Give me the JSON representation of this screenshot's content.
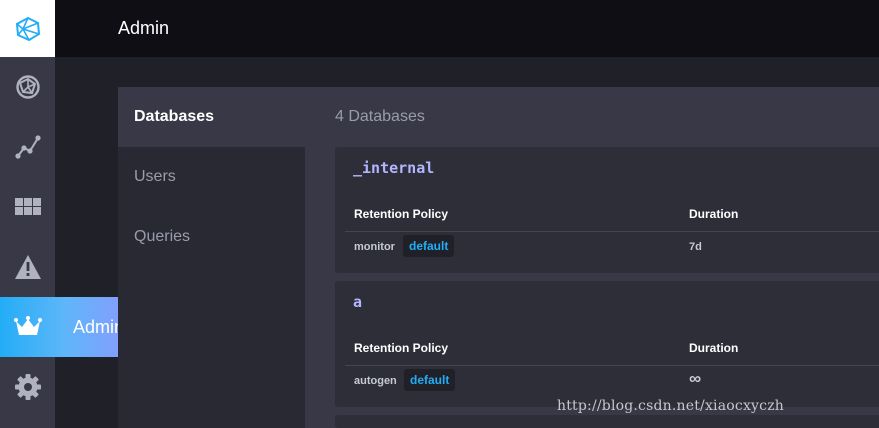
{
  "header": {
    "title": "Admin"
  },
  "rail": {
    "logo_icon": "chronograf-logo-icon",
    "items": [
      {
        "icon": "host-list-icon"
      },
      {
        "icon": "data-explorer-icon"
      },
      {
        "icon": "dashboards-icon"
      },
      {
        "icon": "alert-icon"
      },
      {
        "icon": "crown-icon",
        "label": "Admin",
        "active": true
      },
      {
        "icon": "gear-icon"
      }
    ],
    "active_gradient": [
      "#22adf6",
      "#9394ff"
    ]
  },
  "subnav": {
    "items": [
      {
        "label": "Databases",
        "active": true
      },
      {
        "label": "Users"
      },
      {
        "label": "Queries"
      }
    ]
  },
  "main": {
    "heading": "4 Databases",
    "databases": [
      {
        "name": "_internal",
        "columns": [
          "Retention Policy",
          "Duration"
        ],
        "policies": [
          {
            "name": "monitor",
            "badge": "default",
            "duration": "7d"
          }
        ]
      },
      {
        "name": "a",
        "columns": [
          "Retention Policy",
          "Duration"
        ],
        "policies": [
          {
            "name": "autogen",
            "badge": "default",
            "duration": "∞"
          }
        ]
      }
    ]
  },
  "watermark": "http://blog.csdn.net/xiaocxyczh",
  "colors": {
    "accent": "#22adf6",
    "db_name": "#b1b6ff",
    "background": "#202028"
  }
}
